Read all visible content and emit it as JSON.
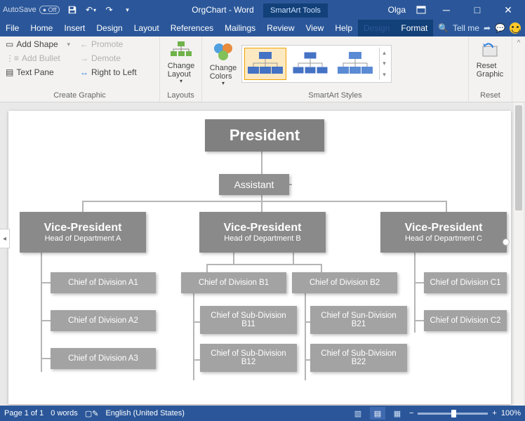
{
  "titlebar": {
    "autosave_label": "AutoSave",
    "autosave_state": "Off",
    "title": "OrgChart - Word",
    "context_tab": "SmartArt Tools",
    "user": "Olga"
  },
  "menu": {
    "items": [
      "File",
      "Home",
      "Insert",
      "Design",
      "Layout",
      "References",
      "Mailings",
      "Review",
      "View",
      "Help"
    ],
    "context_items": [
      "Design",
      "Format"
    ],
    "active_context": 0,
    "tellme": "Tell me"
  },
  "ribbon": {
    "create": {
      "add_shape": "Add Shape",
      "add_bullet": "Add Bullet",
      "text_pane": "Text Pane",
      "promote": "Promote",
      "demote": "Demote",
      "rtl": "Right to Left",
      "label": "Create Graphic"
    },
    "layouts": {
      "btn": "Change\nLayout",
      "label": "Layouts"
    },
    "styles": {
      "colors": "Change\nColors",
      "label": "SmartArt Styles"
    },
    "reset": {
      "btn": "Reset\nGraphic",
      "label": "Reset"
    }
  },
  "chart_data": {
    "type": "orgchart",
    "nodes": {
      "root": {
        "title": "President"
      },
      "assistant": {
        "title": "Assistant"
      },
      "vp": [
        {
          "title": "Vice-President",
          "sub": "Head of Department A"
        },
        {
          "title": "Vice-President",
          "sub": "Head of Department B"
        },
        {
          "title": "Vice-President",
          "sub": "Head of Department C"
        }
      ],
      "a": [
        "Chief of Division A1",
        "Chief of Division A2",
        "Chief of Division A3"
      ],
      "b_top": [
        "Chief of Division B1",
        "Chief of Division B2"
      ],
      "b_sub": [
        "Chief of Sub-Division B11",
        "Chief of Sun-Division B21",
        "Chief of Sub-Division B12",
        "Chief of Sub-Division B22"
      ],
      "c": [
        "Chief of Division C1",
        "Chief of Division C2"
      ]
    }
  },
  "status": {
    "page": "Page 1 of 1",
    "words": "0 words",
    "lang": "English (United States)",
    "zoom": "100%"
  }
}
